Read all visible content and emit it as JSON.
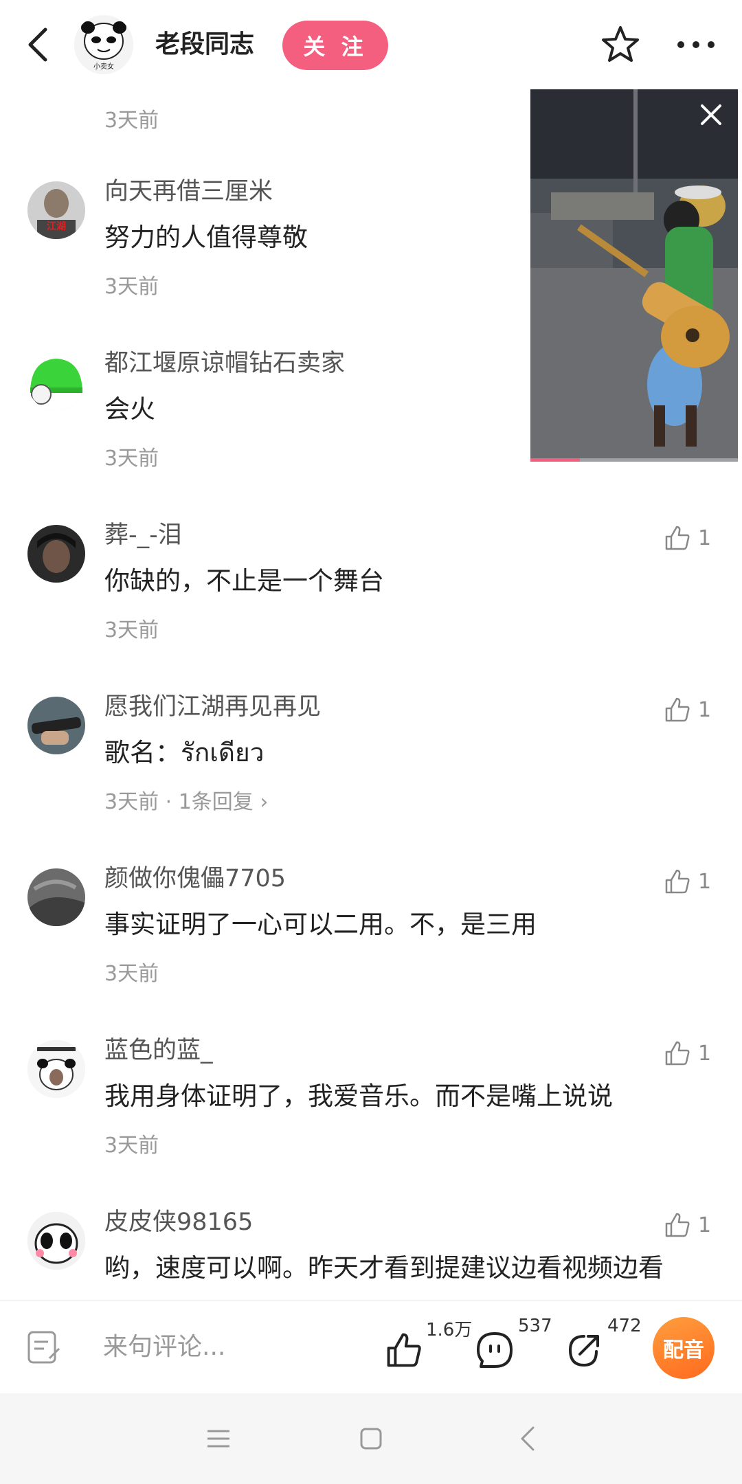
{
  "header": {
    "author_name": "老段同志",
    "follow_label": "关 注",
    "avatar_caption": "小卖女"
  },
  "top_comment_time": "3天前",
  "comments": [
    {
      "name": "向天再借三厘米",
      "text": "努力的人值得尊敬",
      "time": "3天前",
      "likes": "",
      "avatar_label": "江湖"
    },
    {
      "name": "都江堰原谅帽钻石卖家",
      "text": "会火",
      "time": "3天前",
      "likes": ""
    },
    {
      "name": "葬-_-泪",
      "text": "你缺的，不止是一个舞台",
      "time": "3天前",
      "likes": "1"
    },
    {
      "name": "愿我们江湖再见再见",
      "text": "歌名：รักเดียว",
      "time": "3天前 · ",
      "reply": "1条回复 ›",
      "likes": "1"
    },
    {
      "name": "颜做你傀儡7705",
      "text": "事实证明了一心可以二用。不，是三用",
      "time": "3天前",
      "likes": "1"
    },
    {
      "name": "蓝色的蓝_",
      "text": "我用身体证明了，我爱音乐。而不是嘴上说说",
      "time": "3天前",
      "likes": "1"
    },
    {
      "name": "皮皮侠98165",
      "text": "哟，速度可以啊。昨天才看到提建议边看视频边看",
      "time": "",
      "likes": "1"
    }
  ],
  "video": {
    "progress": 0.24
  },
  "bottom_bar": {
    "input_placeholder": "来句评论...",
    "like_count": "1.6万",
    "comment_count": "537",
    "share_count": "472",
    "dub_label": "配音"
  },
  "colors": {
    "accent": "#f45f80",
    "dub": "#ff7a26"
  }
}
